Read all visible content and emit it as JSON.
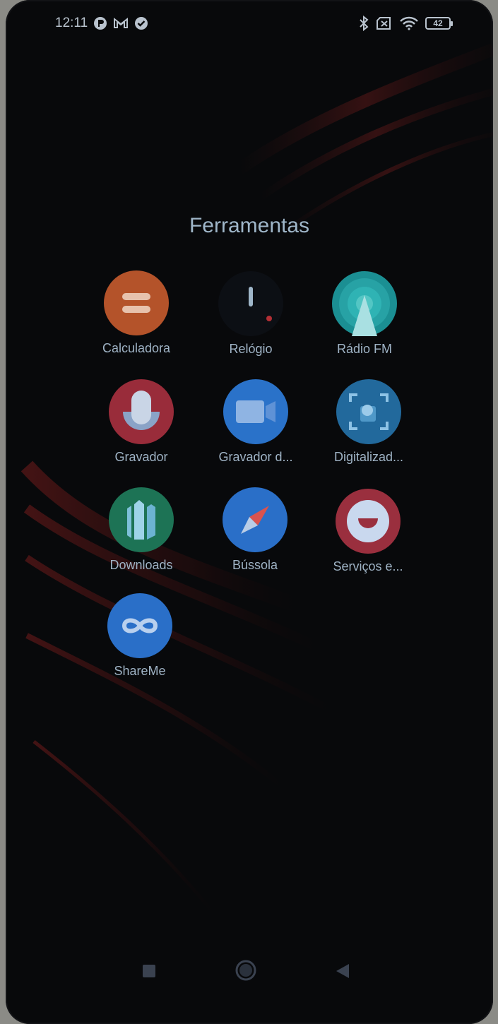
{
  "status_bar": {
    "time": "12:11",
    "battery_level": "42",
    "left_icons": [
      "app-notification-icon",
      "gmail-icon",
      "check-badge-icon"
    ],
    "right_icons": [
      "bluetooth-icon",
      "no-sim-icon",
      "wifi-icon",
      "battery-icon"
    ]
  },
  "folder": {
    "title": "Ferramentas",
    "apps": [
      {
        "label": "Calculadora",
        "icon": "calculator-icon",
        "color": "#b4532a"
      },
      {
        "label": "Relógio",
        "icon": "clock-icon",
        "color": "#0c0f14"
      },
      {
        "label": "Rádio FM",
        "icon": "radio-icon",
        "color": "#1b8f93"
      },
      {
        "label": "Gravador",
        "icon": "microphone-icon",
        "color": "#992c3a"
      },
      {
        "label": "Gravador d...",
        "icon": "video-camera-icon",
        "color": "#2a72c9"
      },
      {
        "label": "Digitalizad...",
        "icon": "scanner-icon",
        "color": "#22699c"
      },
      {
        "label": "Downloads",
        "icon": "downloads-icon",
        "color": "#1d7355"
      },
      {
        "label": "Bússola",
        "icon": "compass-icon",
        "color": "#2a6fc8"
      },
      {
        "label": "Serviços e...",
        "icon": "services-feedback-icon",
        "color": "#9a2f3e"
      },
      {
        "label": "ShareMe",
        "icon": "shareme-icon",
        "color": "#2a6fc8"
      }
    ]
  },
  "nav_bar": {
    "buttons": [
      "recents-square-icon",
      "home-circle-icon",
      "back-triangle-icon"
    ]
  }
}
